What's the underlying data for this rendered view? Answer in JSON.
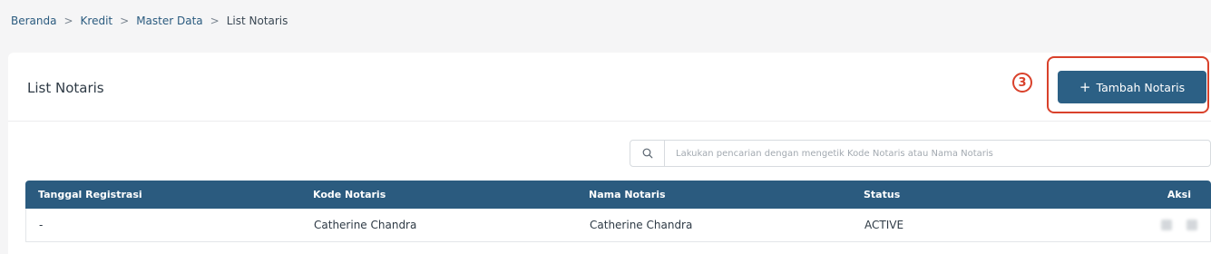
{
  "breadcrumb": {
    "items": [
      "Beranda",
      "Kredit",
      "Master Data"
    ],
    "current": "List Notaris",
    "separator": ">"
  },
  "card": {
    "title": "List Notaris",
    "step_number": "3",
    "add_button": {
      "icon": "+",
      "label": "Tambah Notaris"
    }
  },
  "search": {
    "icon": "search-icon",
    "placeholder": "Lakukan pencarian dengan mengetik Kode Notaris atau Nama Notaris",
    "value": ""
  },
  "table": {
    "headers": [
      "Tanggal Registrasi",
      "Kode Notaris",
      "Nama Notaris",
      "Status",
      "Aksi"
    ],
    "rows": [
      {
        "tanggal": "-",
        "kode": "Catherine Chandra",
        "nama": "Catherine Chandra",
        "status": "ACTIVE"
      }
    ]
  },
  "colors": {
    "primary": "#2b5b7f",
    "highlight": "#d9412b"
  }
}
